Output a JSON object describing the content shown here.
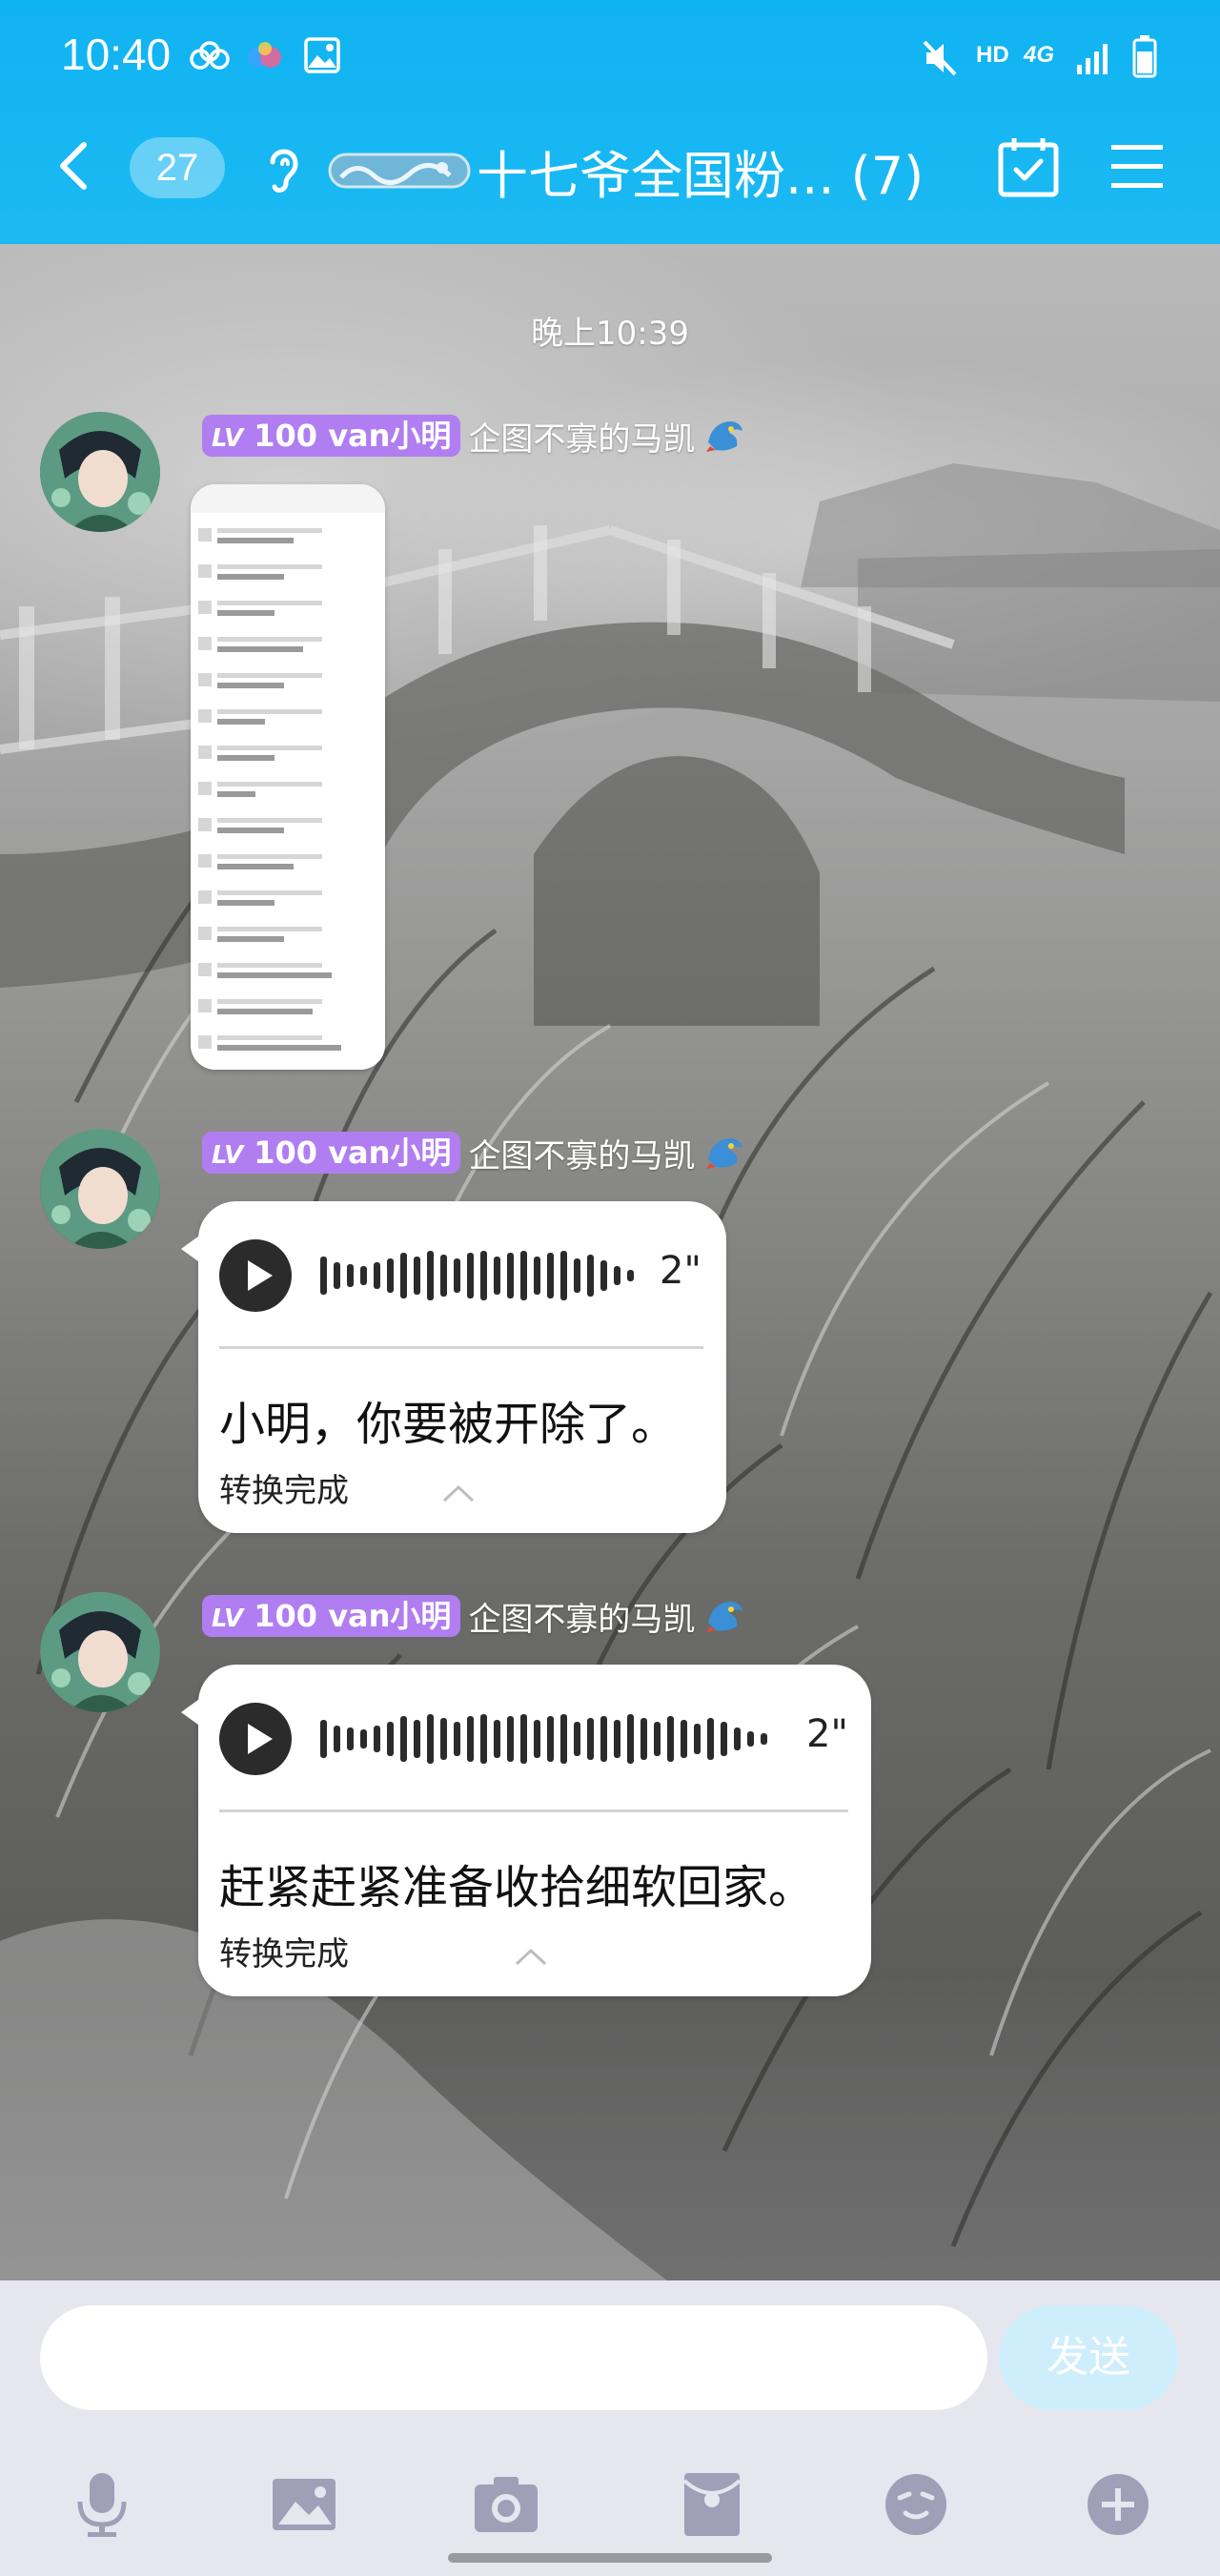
{
  "status_bar": {
    "time": "10:40",
    "network_label": "HD",
    "network_type_label": "4G"
  },
  "header": {
    "unread_count": "27",
    "group_title": "十七爷全国粉... (7)",
    "accent": "#12b4f1"
  },
  "chat": {
    "timestamp": "晚上10:39",
    "messages": [
      {
        "level_prefix": "LV",
        "level_value": "100",
        "sender_name": "van小明",
        "title": "企图不寡的马凯",
        "type": "image"
      },
      {
        "level_prefix": "LV",
        "level_value": "100",
        "sender_name": "van小明",
        "title": "企图不寡的马凯",
        "type": "voice",
        "duration": "2\"",
        "transcript": "小明，你要被开除了。",
        "status": "转换完成"
      },
      {
        "level_prefix": "LV",
        "level_value": "100",
        "sender_name": "van小明",
        "title": "企图不寡的马凯",
        "type": "voice",
        "duration": "2\"",
        "transcript": "赶紧赶紧准备收拾细软回家。",
        "status": "转换完成"
      }
    ]
  },
  "input": {
    "value": "",
    "send_label": "发送"
  },
  "toolbar": {
    "icons": [
      "microphone-icon",
      "image-icon",
      "camera-icon",
      "red-packet-icon",
      "emoji-icon",
      "plus-icon"
    ]
  },
  "colors": {
    "level_badge": "#b07ef0",
    "send_button": "#cfeefb",
    "input_bar": "#e6e6ef",
    "toolbar_icon": "#9f9fb7"
  }
}
